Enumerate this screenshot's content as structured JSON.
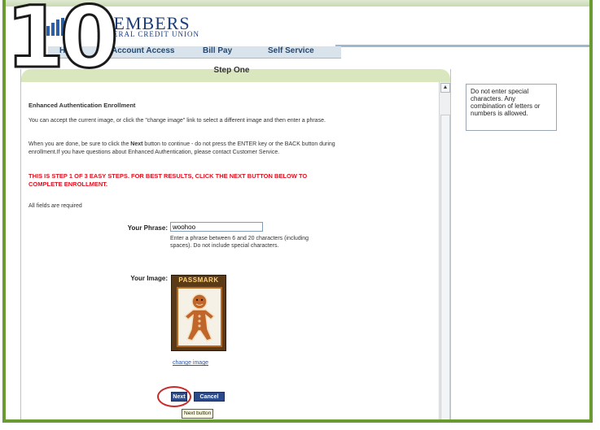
{
  "step_badge": "10",
  "logo": {
    "big": "MEMBERS",
    "small": "FEDERAL CREDIT UNION"
  },
  "nav": {
    "items": [
      "Home",
      "Account Access",
      "Bill Pay",
      "Self Service"
    ]
  },
  "panel": {
    "title": "Step One",
    "heading": "Enhanced Authentication Enrollment",
    "p1": "You can accept the current image, or click the \"change image\" link to select a different image and then enter a phrase.",
    "p2_pre": "When you are done, be sure to click the ",
    "p2_bold": "Next",
    "p2_post": " button to continue - do not press the ENTER key or the BACK button during enrollment.If you have questions about Enhanced Authentication, please contact Customer Service.",
    "warning": "THIS IS STEP 1 OF 3 EASY STEPS. FOR BEST RESULTS, CLICK THE NEXT BUTTON BELOW TO COMPLETE ENROLLMENT.",
    "required": "All fields are required",
    "phrase_label": "Your Phrase:",
    "phrase_value": "woohoo",
    "phrase_hint": "Enter a phrase between 6 and 20 characters (including spaces). Do not include special characters.",
    "image_label": "Your Image:",
    "image_banner": "PASSMARK",
    "change_image": "change image",
    "next": "Next",
    "cancel": "Cancel",
    "tooltip": "Next button"
  },
  "side_help": "Do not enter special characters. Any combination of letters or numbers is allowed.",
  "colors": {
    "frame": "#6a9a32",
    "header": "#d9e6be",
    "warning": "#e01020",
    "button": "#2b4a8a",
    "highlight": "#c92a2a"
  }
}
